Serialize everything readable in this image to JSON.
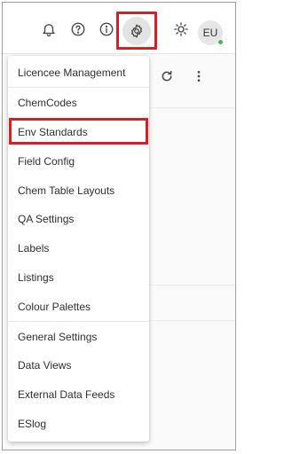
{
  "toolbar": {
    "icons": [
      "bell-icon",
      "help-icon",
      "info-icon",
      "gear-icon",
      "brightness-icon"
    ],
    "avatar_initials": "EU",
    "avatar_status_color": "#4caf50"
  },
  "page": {
    "icons": [
      "refresh-icon",
      "more-vert-icon"
    ]
  },
  "menu": {
    "items": [
      {
        "label": "Licencee Management"
      },
      {
        "label": "ChemCodes"
      },
      {
        "label": "Env Standards"
      },
      {
        "label": "Field Config"
      },
      {
        "label": "Chem Table Layouts"
      },
      {
        "label": "QA Settings"
      },
      {
        "label": "Labels"
      },
      {
        "label": "Listings"
      },
      {
        "label": "Colour Palettes"
      },
      {
        "label": "General Settings"
      },
      {
        "label": "Data Views"
      },
      {
        "label": "External Data Feeds"
      },
      {
        "label": "ESlog"
      }
    ],
    "highlighted": "Env Standards"
  },
  "colors": {
    "highlight_border": "#d71f26"
  }
}
